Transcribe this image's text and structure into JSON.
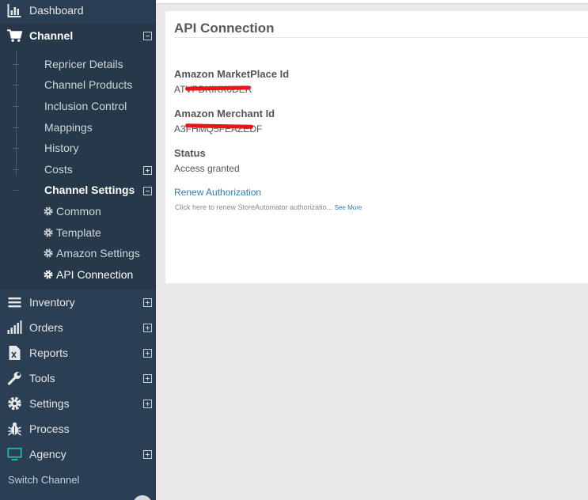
{
  "sidebar": {
    "dashboard": "Dashboard",
    "channel": "Channel",
    "channel_sub": [
      "Repricer Details",
      "Channel Products",
      "Inclusion Control",
      "Mappings",
      "History",
      "Costs",
      "Channel Settings"
    ],
    "channel_settings_sub": [
      "Common",
      "Template",
      "Amazon Settings",
      "API Connection"
    ],
    "inventory": "Inventory",
    "orders": "Orders",
    "reports": "Reports",
    "tools": "Tools",
    "settings": "Settings",
    "process": "Process",
    "agency": "Agency",
    "switch_channel": "Switch Channel"
  },
  "panel": {
    "title": "API Connection",
    "marketplace_label": "Amazon MarketPlace Id",
    "marketplace_value": "ATVPDKIKX0DER",
    "merchant_label": "Amazon Merchant Id",
    "merchant_value": "A3FHMQ5FEAZEDF",
    "status_label": "Status",
    "status_value": "Access granted",
    "renew_link": "Renew Authorization",
    "renew_help": "Click here to renew StoreAutomator authorizatio...",
    "see_more": "See More"
  },
  "colors": {
    "sidebar_bg": "#2a3f54",
    "link": "#337ab7",
    "redaction": "#e8151a",
    "agency_icon": "#26b99a"
  }
}
